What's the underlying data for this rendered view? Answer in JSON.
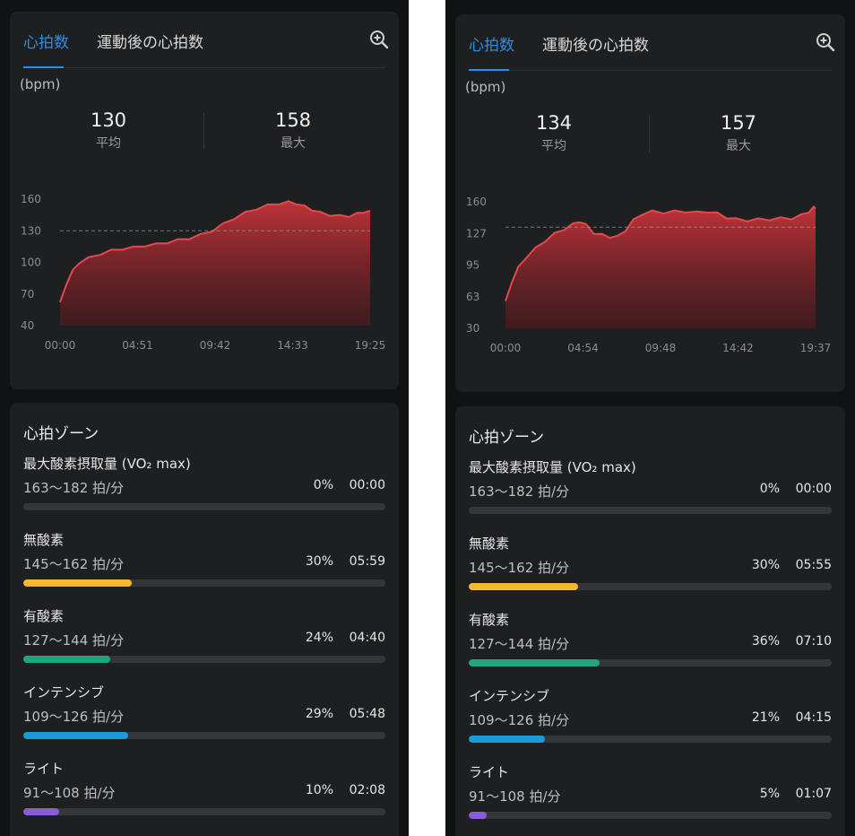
{
  "screens": [
    {
      "tabs": {
        "heart_rate": "心拍数",
        "post_exercise": "運動後の心拍数"
      },
      "unit": "(bpm)",
      "stats": {
        "avg": {
          "value": "130",
          "label": "平均"
        },
        "max": {
          "value": "158",
          "label": "最大"
        }
      },
      "chart_data": {
        "type": "area",
        "ylabel": "(bpm)",
        "ylim": [
          40,
          160
        ],
        "y_ticks": [
          "160",
          "130",
          "100",
          "70",
          "40"
        ],
        "x_ticks": [
          "00:00",
          "04:51",
          "09:42",
          "14:33",
          "19:25"
        ],
        "xlim_minutes": [
          0,
          19.42
        ],
        "average_line": 130,
        "series": [
          {
            "values": [
              [
                0,
                62
              ],
              [
                0.4,
                80
              ],
              [
                0.8,
                92
              ],
              [
                1.2,
                100
              ],
              [
                1.8,
                104
              ],
              [
                2.5,
                108
              ],
              [
                3.2,
                111
              ],
              [
                3.9,
                113
              ],
              [
                4.6,
                114
              ],
              [
                5.3,
                116
              ],
              [
                6.0,
                117
              ],
              [
                6.7,
                119
              ],
              [
                7.4,
                121
              ],
              [
                8.1,
                123
              ],
              [
                8.8,
                126
              ],
              [
                9.5,
                130
              ],
              [
                10.2,
                136
              ],
              [
                10.9,
                142
              ],
              [
                11.6,
                147
              ],
              [
                12.3,
                151
              ],
              [
                13.0,
                154
              ],
              [
                13.7,
                156
              ],
              [
                14.3,
                157
              ],
              [
                14.8,
                156
              ],
              [
                15.3,
                153
              ],
              [
                15.8,
                150
              ],
              [
                16.3,
                147
              ],
              [
                16.9,
                145
              ],
              [
                17.5,
                144
              ],
              [
                18.1,
                144
              ],
              [
                18.6,
                146
              ],
              [
                19.0,
                148
              ],
              [
                19.42,
                149
              ]
            ]
          }
        ]
      },
      "zones_title": "心拍ゾーン",
      "zones": [
        {
          "name": "最大酸素摂取量 (VO₂ max)",
          "range": "163〜182 拍/分",
          "percent": "0%",
          "time": "00:00",
          "fraction": 0,
          "color": "#d33c3c"
        },
        {
          "name": "無酸素",
          "range": "145〜162 拍/分",
          "percent": "30%",
          "time": "05:59",
          "fraction": 0.3,
          "color": "#f5b82e"
        },
        {
          "name": "有酸素",
          "range": "127〜144 拍/分",
          "percent": "24%",
          "time": "04:40",
          "fraction": 0.24,
          "color": "#1fa67f"
        },
        {
          "name": "インテンシブ",
          "range": "109〜126 拍/分",
          "percent": "29%",
          "time": "05:48",
          "fraction": 0.29,
          "color": "#1a9ad6"
        },
        {
          "name": "ライト",
          "range": "91〜108 拍/分",
          "percent": "10%",
          "time": "02:08",
          "fraction": 0.1,
          "color": "#8b5cd6"
        }
      ]
    },
    {
      "tabs": {
        "heart_rate": "心拍数",
        "post_exercise": "運動後の心拍数"
      },
      "unit": "(bpm)",
      "stats": {
        "avg": {
          "value": "134",
          "label": "平均"
        },
        "max": {
          "value": "157",
          "label": "最大"
        }
      },
      "chart_data": {
        "type": "area",
        "ylabel": "(bpm)",
        "ylim": [
          30,
          160
        ],
        "y_ticks": [
          "160",
          "127",
          "95",
          "63",
          "30"
        ],
        "x_ticks": [
          "00:00",
          "04:54",
          "09:48",
          "14:42",
          "19:37"
        ],
        "xlim_minutes": [
          0,
          19.62
        ],
        "average_line": 134,
        "series": [
          {
            "values": [
              [
                0,
                58
              ],
              [
                0.4,
                78
              ],
              [
                0.8,
                92
              ],
              [
                1.3,
                103
              ],
              [
                1.9,
                112
              ],
              [
                2.5,
                120
              ],
              [
                3.1,
                127
              ],
              [
                3.7,
                132
              ],
              [
                4.3,
                137
              ],
              [
                4.7,
                140
              ],
              [
                5.1,
                136
              ],
              [
                5.6,
                128
              ],
              [
                6.1,
                126
              ],
              [
                6.6,
                124
              ],
              [
                7.1,
                124
              ],
              [
                7.6,
                131
              ],
              [
                8.1,
                141
              ],
              [
                8.7,
                148
              ],
              [
                9.3,
                150
              ],
              [
                10.0,
                149
              ],
              [
                10.7,
                150
              ],
              [
                11.4,
                150
              ],
              [
                12.1,
                149
              ],
              [
                12.8,
                150
              ],
              [
                13.4,
                148
              ],
              [
                14.0,
                144
              ],
              [
                14.6,
                142
              ],
              [
                15.3,
                141
              ],
              [
                16.0,
                142
              ],
              [
                16.7,
                142
              ],
              [
                17.4,
                143
              ],
              [
                18.1,
                143
              ],
              [
                18.7,
                146
              ],
              [
                19.2,
                150
              ],
              [
                19.5,
                154
              ],
              [
                19.62,
                153
              ]
            ]
          }
        ]
      },
      "zones_title": "心拍ゾーン",
      "zones": [
        {
          "name": "最大酸素摂取量 (VO₂ max)",
          "range": "163〜182 拍/分",
          "percent": "0%",
          "time": "00:00",
          "fraction": 0,
          "color": "#d33c3c"
        },
        {
          "name": "無酸素",
          "range": "145〜162 拍/分",
          "percent": "30%",
          "time": "05:55",
          "fraction": 0.3,
          "color": "#f5b82e"
        },
        {
          "name": "有酸素",
          "range": "127〜144 拍/分",
          "percent": "36%",
          "time": "07:10",
          "fraction": 0.36,
          "color": "#1fa67f"
        },
        {
          "name": "インテンシブ",
          "range": "109〜126 拍/分",
          "percent": "21%",
          "time": "04:15",
          "fraction": 0.21,
          "color": "#1a9ad6"
        },
        {
          "name": "ライト",
          "range": "91〜108 拍/分",
          "percent": "5%",
          "time": "01:07",
          "fraction": 0.05,
          "color": "#8b5cd6"
        }
      ]
    }
  ],
  "icons": {
    "zoom": "zoom-in-icon"
  },
  "colors": {
    "accent": "#2f8ce6",
    "chart_line": "#e5484d",
    "chart_fill_top": "#c7343a",
    "card": "#1e1f21",
    "background": "#111214"
  }
}
